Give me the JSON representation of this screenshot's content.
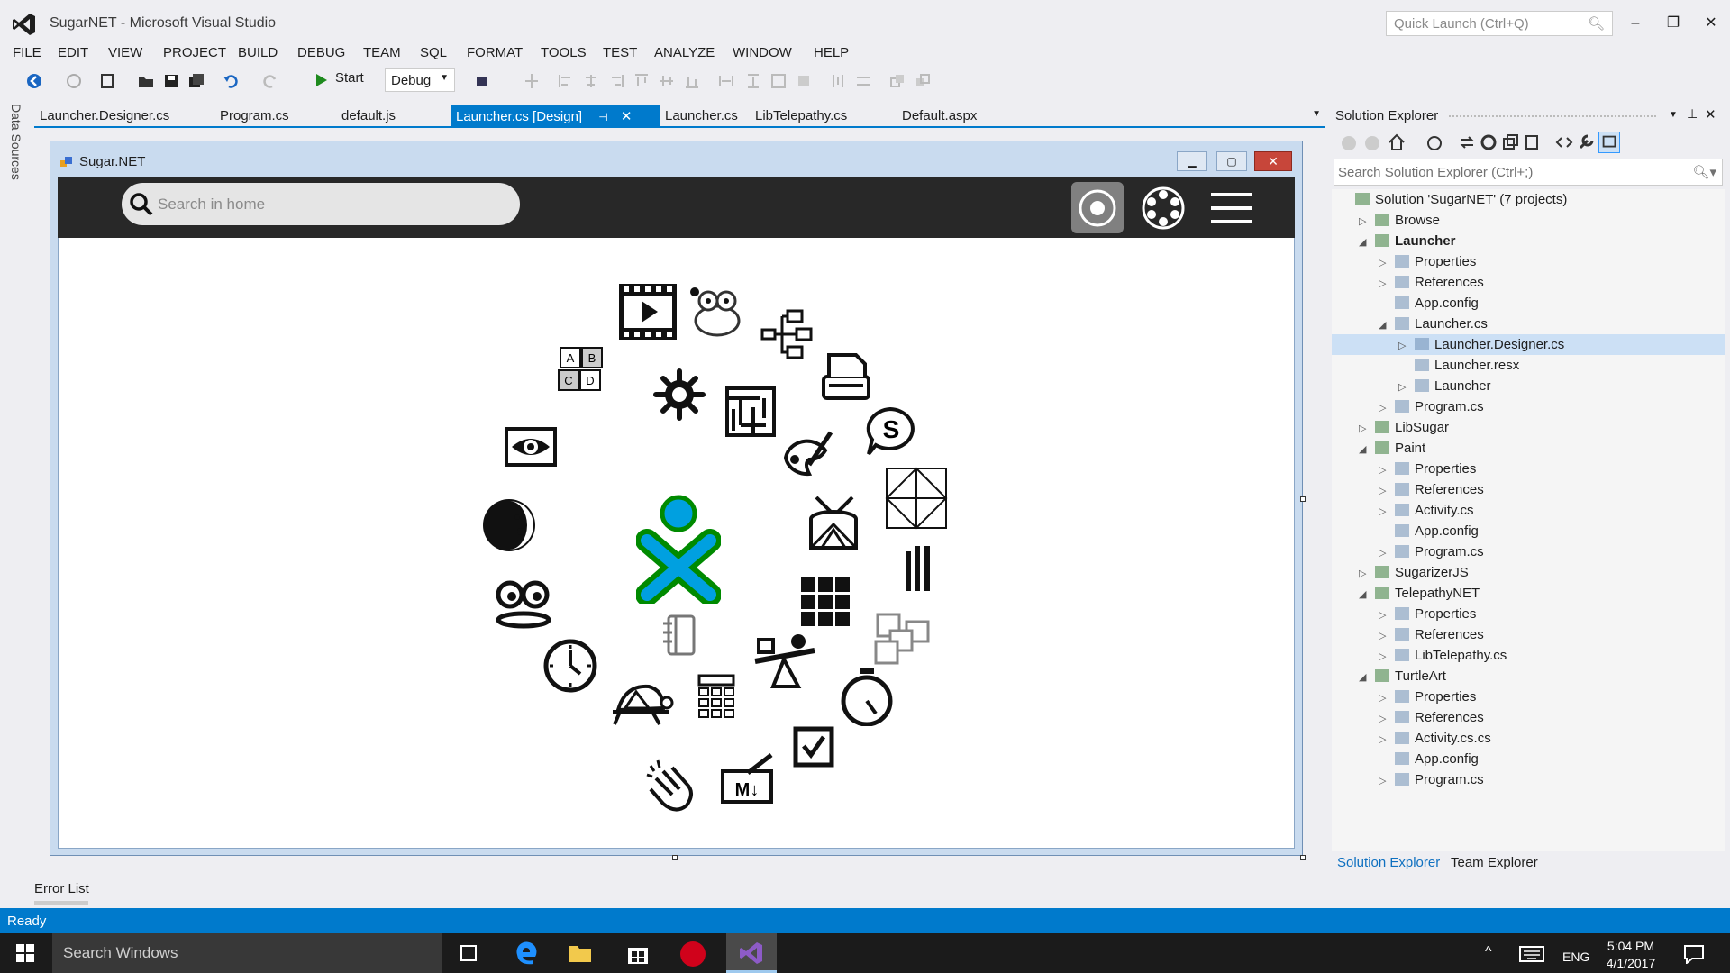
{
  "window": {
    "title": "SugarNET - Microsoft Visual Studio",
    "quick_launch_placeholder": "Quick Launch (Ctrl+Q)"
  },
  "menu": [
    "FILE",
    "EDIT",
    "VIEW",
    "PROJECT",
    "BUILD",
    "DEBUG",
    "TEAM",
    "SQL",
    "FORMAT",
    "TOOLS",
    "TEST",
    "ANALYZE",
    "WINDOW",
    "HELP"
  ],
  "toolbar": {
    "start_label": "Start",
    "configuration": "Debug"
  },
  "left_rail": {
    "data_sources": "Data Sources"
  },
  "doc_tabs": [
    "Launcher.Designer.cs",
    "Program.cs",
    "default.js",
    "Launcher.cs [Design]",
    "Launcher.cs",
    "LibTelepathy.cs",
    "Default.aspx"
  ],
  "designer": {
    "form_title": "Sugar.NET",
    "search_placeholder": "Search in home"
  },
  "solution_explorer": {
    "title": "Solution Explorer",
    "search_placeholder": "Search Solution Explorer (Ctrl+;)",
    "items": [
      {
        "label": "Solution 'SugarNET' (7 projects)",
        "level": 0,
        "twisty": ""
      },
      {
        "label": "Browse",
        "level": 1,
        "twisty": "▷"
      },
      {
        "label": "Launcher",
        "level": 1,
        "twisty": "◢",
        "bold": true
      },
      {
        "label": "Properties",
        "level": 2,
        "twisty": "▷"
      },
      {
        "label": "References",
        "level": 2,
        "twisty": "▷"
      },
      {
        "label": "App.config",
        "level": 2,
        "twisty": ""
      },
      {
        "label": "Launcher.cs",
        "level": 2,
        "twisty": "◢"
      },
      {
        "label": "Launcher.Designer.cs",
        "level": 3,
        "twisty": "▷",
        "selected": true
      },
      {
        "label": "Launcher.resx",
        "level": 3,
        "twisty": ""
      },
      {
        "label": "Launcher",
        "level": 3,
        "twisty": "▷"
      },
      {
        "label": "Program.cs",
        "level": 2,
        "twisty": "▷"
      },
      {
        "label": "LibSugar",
        "level": 1,
        "twisty": "▷"
      },
      {
        "label": "Paint",
        "level": 1,
        "twisty": "◢"
      },
      {
        "label": "Properties",
        "level": 2,
        "twisty": "▷"
      },
      {
        "label": "References",
        "level": 2,
        "twisty": "▷"
      },
      {
        "label": "Activity.cs",
        "level": 2,
        "twisty": "▷"
      },
      {
        "label": "App.config",
        "level": 2,
        "twisty": ""
      },
      {
        "label": "Program.cs",
        "level": 2,
        "twisty": "▷"
      },
      {
        "label": "SugarizerJS",
        "level": 1,
        "twisty": "▷"
      },
      {
        "label": "TelepathyNET",
        "level": 1,
        "twisty": "◢"
      },
      {
        "label": "Properties",
        "level": 2,
        "twisty": "▷"
      },
      {
        "label": "References",
        "level": 2,
        "twisty": "▷"
      },
      {
        "label": "LibTelepathy.cs",
        "level": 2,
        "twisty": "▷"
      },
      {
        "label": "TurtleArt",
        "level": 1,
        "twisty": "◢"
      },
      {
        "label": "Properties",
        "level": 2,
        "twisty": "▷"
      },
      {
        "label": "References",
        "level": 2,
        "twisty": "▷"
      },
      {
        "label": "Activity.cs.cs",
        "level": 2,
        "twisty": "▷"
      },
      {
        "label": "App.config",
        "level": 2,
        "twisty": ""
      },
      {
        "label": "Program.cs",
        "level": 2,
        "twisty": "▷"
      }
    ],
    "bottom_tabs": [
      "Solution Explorer",
      "Team Explorer"
    ]
  },
  "error_list": "Error List",
  "status": "Ready",
  "taskbar": {
    "search": "Search Windows",
    "lang": "ENG",
    "time": "5:04 PM",
    "date": "4/1/2017"
  },
  "colors": {
    "accent": "#007acc",
    "sugar_blue": "#00a0e0",
    "sugar_green": "#008a00"
  }
}
